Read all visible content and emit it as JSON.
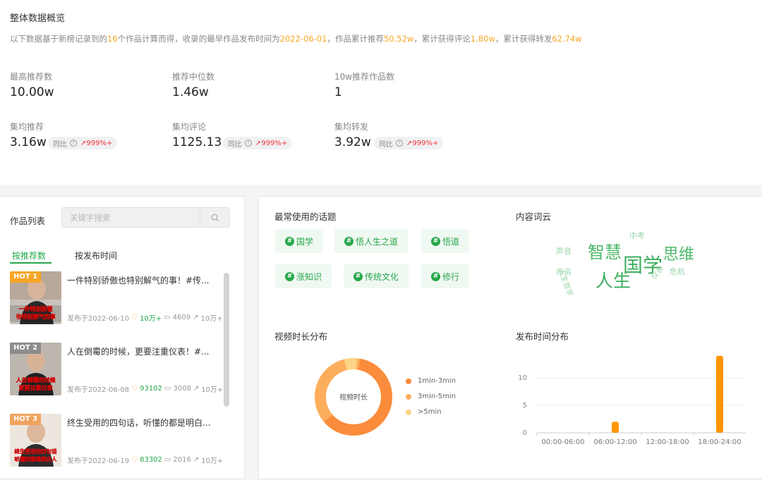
{
  "overview": {
    "title": "整体数据概览",
    "summary": {
      "p1": "以下数据基于新榜记录到的",
      "count": "16",
      "p2": "个作品计算而得，收录的最早作品发布时间为",
      "date": "2022-06-01",
      "p3": "，作品累计推荐",
      "recommend": "50.52w",
      "p4": "，累计获得评论",
      "comments": "1.80w",
      "p5": "，累计获得转发",
      "shares": "62.74w"
    },
    "metrics": {
      "max_rec_label": "最高推荐数",
      "max_rec_value": "10.00w",
      "median_rec_label": "推荐中位数",
      "median_rec_value": "1.46w",
      "over10w_label": "10w推荐作品数",
      "over10w_value": "1",
      "avg_rec_label": "集均推荐",
      "avg_rec_value": "3.16w",
      "avg_comment_label": "集均评论",
      "avg_comment_value": "1125.13",
      "avg_share_label": "集均转发",
      "avg_share_value": "3.92w"
    },
    "badge": {
      "label": "同比",
      "help": "?",
      "value": "999%+"
    }
  },
  "works": {
    "title": "作品列表",
    "search_placeholder": "关键字搜索",
    "tabs": [
      "按推荐数",
      "按发布时间"
    ],
    "items": [
      {
        "hot": "HOT 1",
        "title": "一件特别骄傲也特别解气的事！#传...",
        "date": "发布于2022-06-10",
        "likes": "10万+",
        "comments": "4609",
        "shares": "10万+",
        "caption": "一件特别骄傲也特别解气的事"
      },
      {
        "hot": "HOT 2",
        "title": "人在倒霉的时候，更要注重仪表！#...",
        "date": "发布于2022-06-08",
        "likes": "93102",
        "comments": "3008",
        "shares": "10万+",
        "caption": "人在倒霉的时候更要注重仪表"
      },
      {
        "hot": "HOT 3",
        "title": "终生受用的四句话，听懂的都是明白...",
        "date": "发布于2022-06-19",
        "likes": "83302",
        "comments": "2016",
        "shares": "10万+",
        "caption": "终生受用的四句话听懂的都是明白人"
      }
    ]
  },
  "topics": {
    "title": "最常使用的话题",
    "items": [
      "国学",
      "悟人生之道",
      "悟道",
      "涨知识",
      "传统文化",
      "修行"
    ]
  },
  "word_cloud": {
    "title": "内容词云",
    "words": [
      "智慧",
      "国学",
      "思维",
      "人生",
      "中考",
      "声音",
      "命运",
      "人生哲学",
      "危机",
      "仪表"
    ]
  },
  "duration": {
    "title": "视频时长分布",
    "center_label": "视频时长",
    "legend": [
      "1min-3min",
      "3min-5min",
      ">5min"
    ],
    "colors": [
      "#fa8c3c",
      "#fcae5c",
      "#fdd384"
    ]
  },
  "chart_data": {
    "type": "bar",
    "title": "发布时间分布",
    "categories": [
      "00:00-06:00",
      "06:00-12:00",
      "12:00-18:00",
      "18:00-24:00"
    ],
    "values": [
      0,
      2,
      0,
      14
    ],
    "yticks": [
      0,
      5,
      10
    ],
    "ylim": [
      0,
      15
    ],
    "color": "#ff9500"
  }
}
